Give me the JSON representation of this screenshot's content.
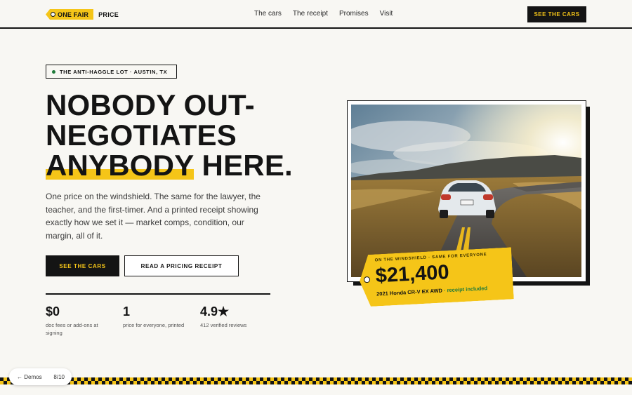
{
  "brand": {
    "tag": "ONE FAIR",
    "word": "PRICE"
  },
  "nav": {
    "links": [
      "The cars",
      "The receipt",
      "Promises",
      "Visit"
    ],
    "cta": "SEE THE CARS"
  },
  "hero": {
    "badge": "THE ANTI-HAGGLE LOT · AUSTIN, TX",
    "headline": {
      "line1": "NOBODY OUT-",
      "line2": "NEGOTIATES",
      "line3_highlight": "ANYBODY",
      "line3_rest": " HERE."
    },
    "lede": "One price on the windshield. The same for the lawyer, the teacher, and the first-timer. And a printed receipt showing exactly how we set it — market comps, condition, our margin, all of it.",
    "primary_cta": "SEE THE CARS",
    "secondary_cta": "READ A PRICING RECEIPT",
    "stats": [
      {
        "value": "$0",
        "label": "doc fees or add-ons at signing"
      },
      {
        "value": "1",
        "label": "price for everyone, printed"
      },
      {
        "value": "4.9★",
        "label": "412 verified reviews"
      }
    ]
  },
  "price_tag": {
    "kicker": "ON THE WINDSHIELD · SAME FOR EVERYONE",
    "price": "$21,400",
    "model": "2021 Honda CR-V EX AWD",
    "receipt_note": " · receipt included"
  },
  "demo_nav": {
    "back": "← Demos",
    "count": "8/10"
  },
  "colors": {
    "accent": "#f5c518",
    "ink": "#141414",
    "background": "#f8f7f3",
    "green": "#1f7a3a"
  }
}
